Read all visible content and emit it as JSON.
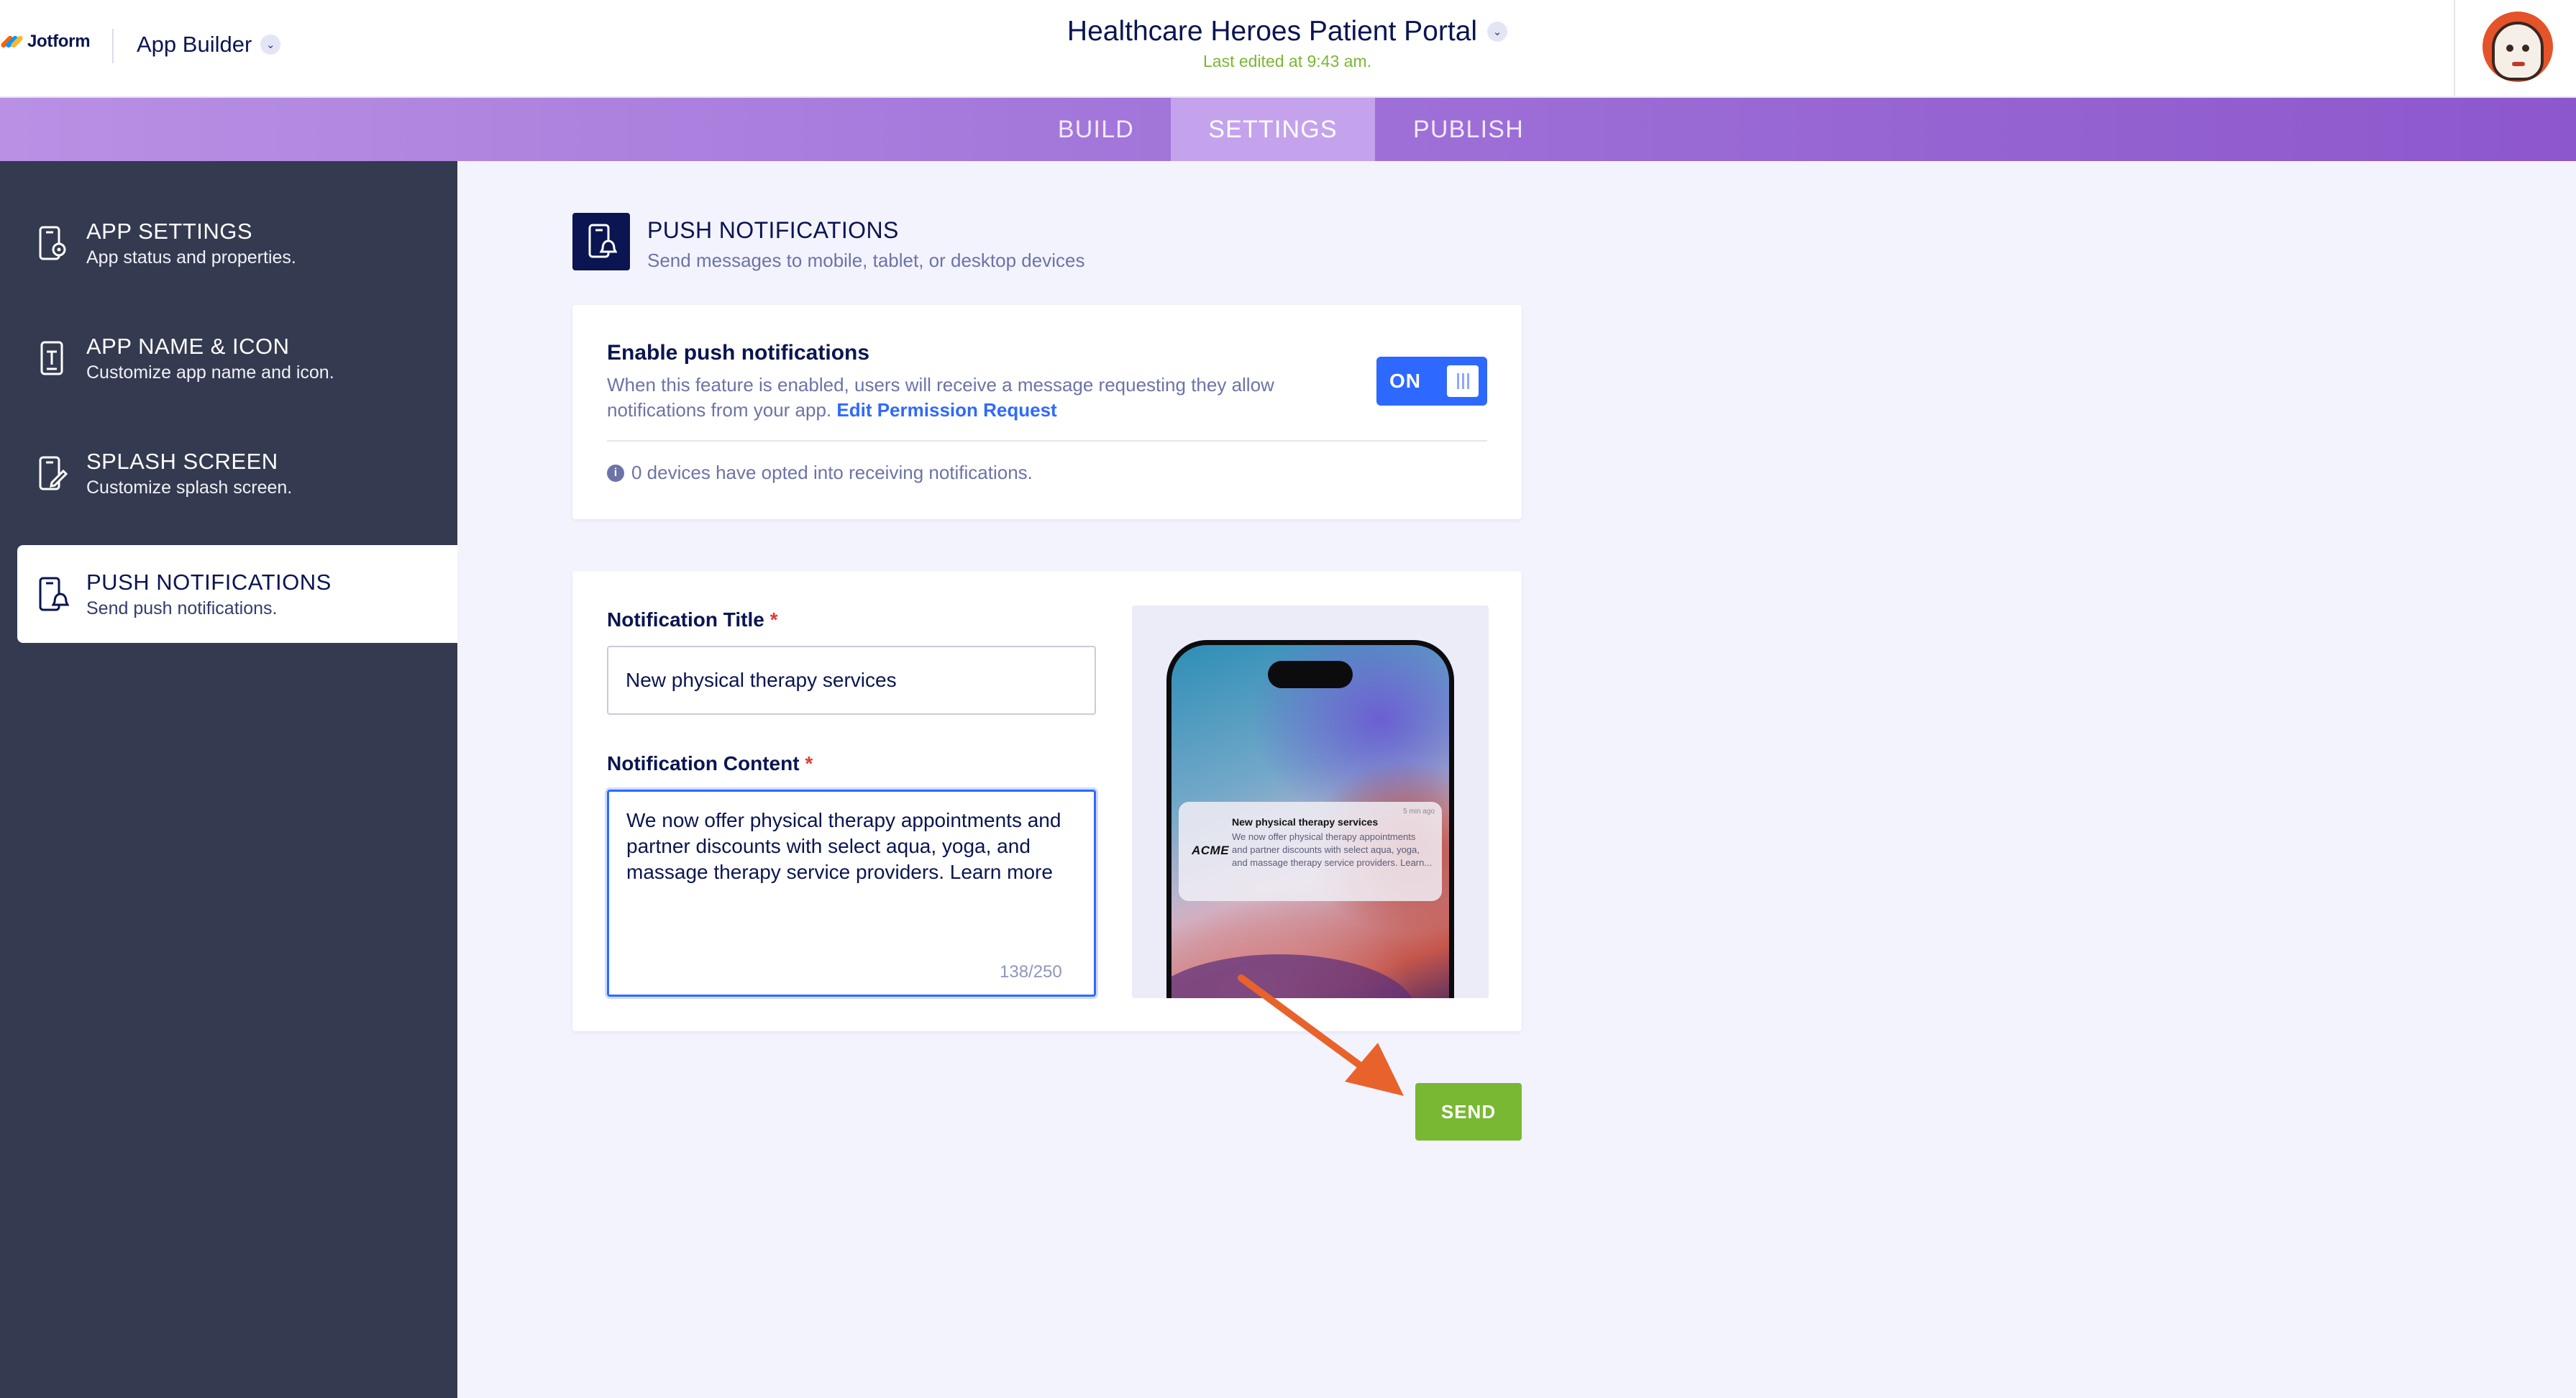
{
  "header": {
    "logo_text": "Jotform",
    "builder_label": "App Builder",
    "app_title": "Healthcare Heroes Patient Portal",
    "last_edited": "Last edited at 9:43 am."
  },
  "tabs": [
    {
      "label": "BUILD"
    },
    {
      "label": "SETTINGS",
      "active": true
    },
    {
      "label": "PUBLISH"
    }
  ],
  "sidebar": {
    "items": [
      {
        "title": "APP SETTINGS",
        "subtitle": "App status and properties.",
        "icon": "phone-gear-icon"
      },
      {
        "title": "APP NAME & ICON",
        "subtitle": "Customize app name and icon.",
        "icon": "phone-text-icon"
      },
      {
        "title": "SPLASH SCREEN",
        "subtitle": "Customize splash screen.",
        "icon": "phone-edit-icon"
      },
      {
        "title": "PUSH NOTIFICATIONS",
        "subtitle": "Send push notifications.",
        "icon": "phone-bell-icon",
        "active": true
      }
    ]
  },
  "section": {
    "title": "PUSH NOTIFICATIONS",
    "subtitle": "Send messages to mobile, tablet, or desktop devices"
  },
  "enable_card": {
    "title": "Enable push notifications",
    "description": "When this feature is enabled, users will receive a message requesting they allow notifications from your app.",
    "link_text": "Edit Permission Request",
    "toggle_label": "ON",
    "info_text": "0 devices have opted into receiving notifications."
  },
  "form": {
    "title_label": "Notification Title",
    "title_value": "New physical therapy services",
    "content_label": "Notification Content",
    "content_value": "We now offer physical therapy appointments and partner discounts with select aqua, yoga, and massage therapy service providers. Learn more",
    "char_count": "138/250",
    "required_mark": "*"
  },
  "preview": {
    "brand": "ACME",
    "time": "5 min ago",
    "title": "New physical therapy services",
    "body": "We now offer physical therapy appointments and partner discounts with select aqua, yoga, and massage therapy service providers. Learn..."
  },
  "send_button": "SEND",
  "colors": {
    "navy": "#0a1551",
    "accent_blue": "#2e69ff",
    "green": "#78b833",
    "sidebar_bg": "#343a4f",
    "arrow": "#e8622c"
  }
}
